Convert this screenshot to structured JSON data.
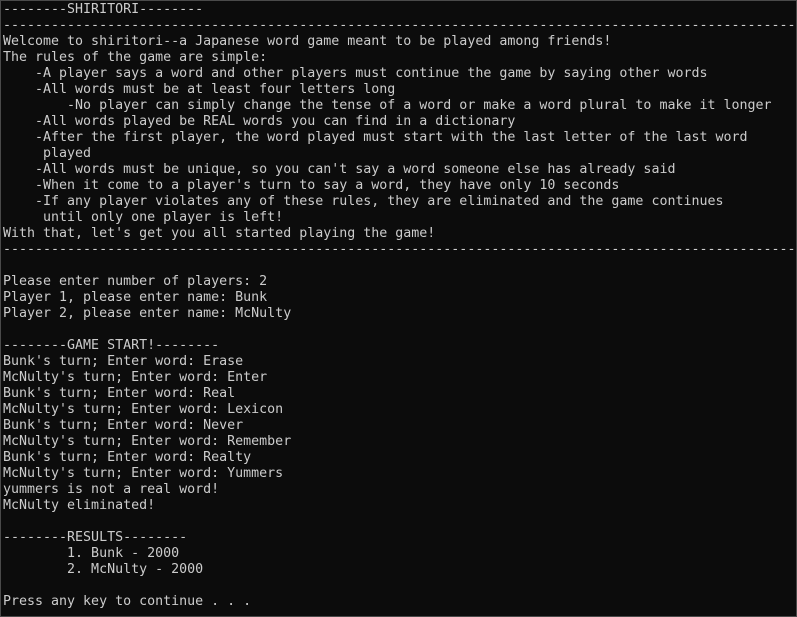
{
  "console": {
    "lines": [
      "--------SHIRITORI--------",
      "-------------------------------------------------------------------------------------------------------",
      "Welcome to shiritori--a Japanese word game meant to be played among friends!",
      "The rules of the game are simple:",
      "    -A player says a word and other players must continue the game by saying other words",
      "    -All words must be at least four letters long",
      "        -No player can simply change the tense of a word or make a word plural to make it longer",
      "    -All words played be REAL words you can find in a dictionary",
      "    -After the first player, the word played must start with the last letter of the last word",
      "     played",
      "    -All words must be unique, so you can't say a word someone else has already said",
      "    -When it come to a player's turn to say a word, they have only 10 seconds",
      "    -If any player violates any of these rules, they are eliminated and the game continues",
      "     until only one player is left!",
      "With that, let's get you all started playing the game!",
      "-------------------------------------------------------------------------------------------------------",
      "",
      "Please enter number of players: 2",
      "Player 1, please enter name: Bunk",
      "Player 2, please enter name: McNulty",
      "",
      "--------GAME START!--------",
      "Bunk's turn; Enter word: Erase",
      "McNulty's turn; Enter word: Enter",
      "Bunk's turn; Enter word: Real",
      "McNulty's turn; Enter word: Lexicon",
      "Bunk's turn; Enter word: Never",
      "McNulty's turn; Enter word: Remember",
      "Bunk's turn; Enter word: Realty",
      "McNulty's turn; Enter word: Yummers",
      "yummers is not a real word!",
      "McNulty eliminated!",
      "",
      "--------RESULTS--------",
      "        1. Bunk - 2000",
      "        2. McNulty - 2000",
      "",
      "Press any key to continue . . ."
    ]
  }
}
